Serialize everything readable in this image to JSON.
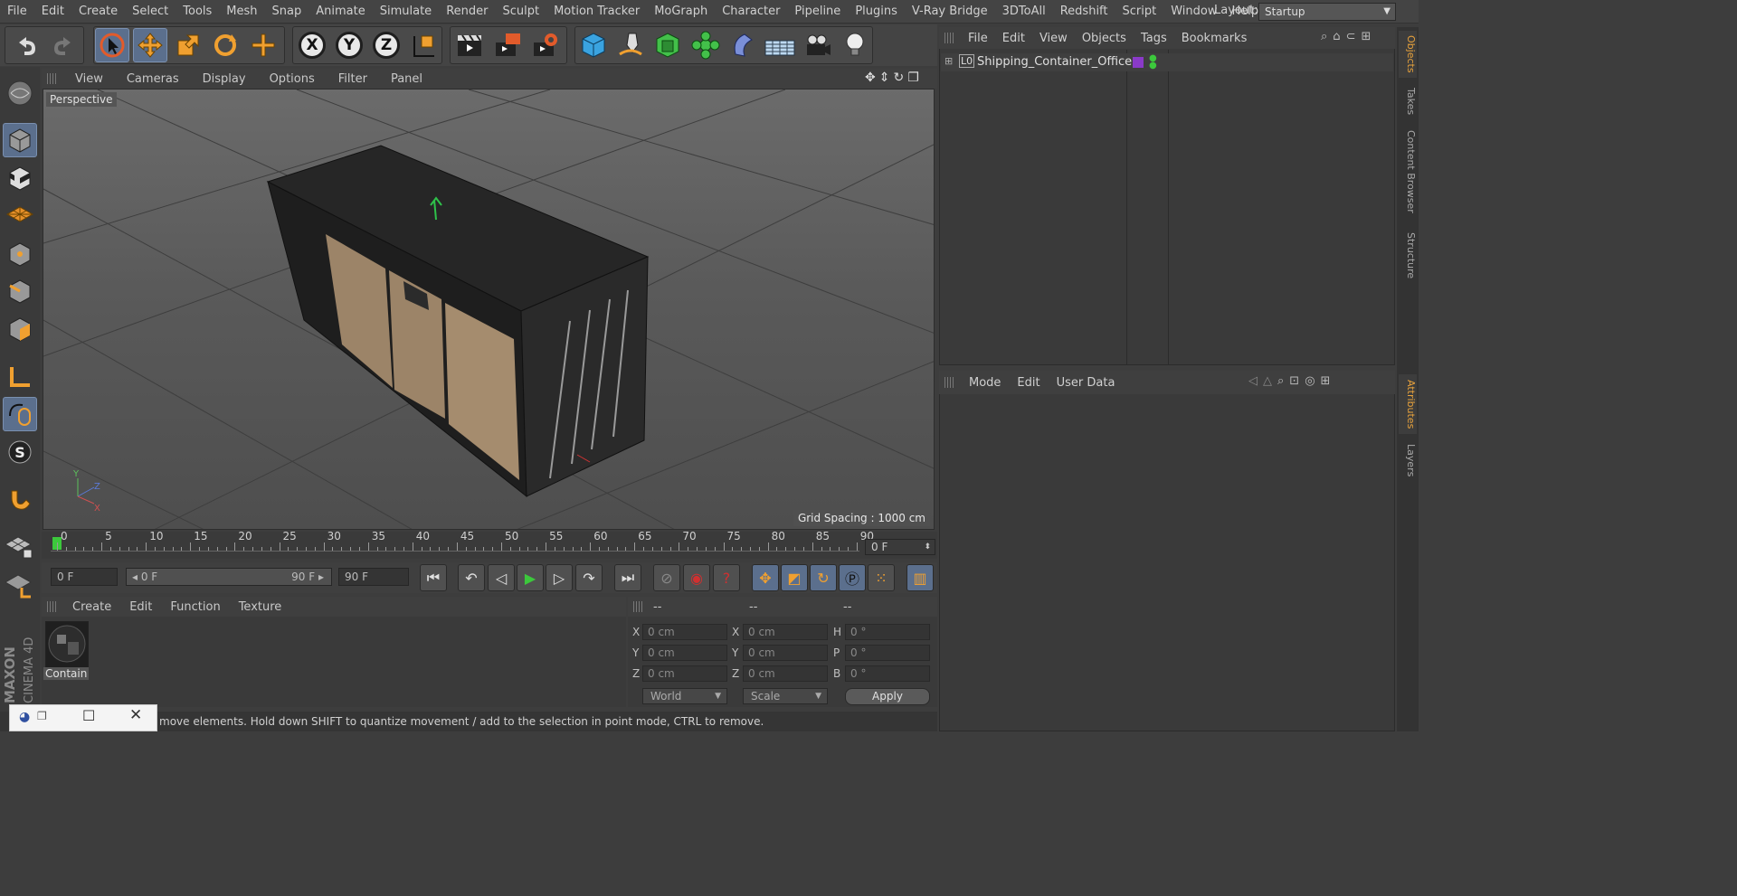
{
  "menubar": {
    "items": [
      "File",
      "Edit",
      "Create",
      "Select",
      "Tools",
      "Mesh",
      "Snap",
      "Animate",
      "Simulate",
      "Render",
      "Sculpt",
      "Motion Tracker",
      "MoGraph",
      "Character",
      "Pipeline",
      "Plugins",
      "V-Ray Bridge",
      "3DToAll",
      "Redshift",
      "Script",
      "Window",
      "Help"
    ],
    "layout_label": "Layout:",
    "layout_value": "Startup"
  },
  "toolbar": {
    "axis_x": "X",
    "axis_y": "Y",
    "axis_z": "Z"
  },
  "viewport": {
    "menu": [
      "View",
      "Cameras",
      "Display",
      "Options",
      "Filter",
      "Panel"
    ],
    "camera_label": "Perspective",
    "grid_spacing": "Grid Spacing : 1000 cm",
    "axis_y": "Y",
    "axis_z": "Z",
    "axis_x": "X"
  },
  "timeline": {
    "ticks": [
      "0",
      "5",
      "10",
      "15",
      "20",
      "25",
      "30",
      "35",
      "40",
      "45",
      "50",
      "55",
      "60",
      "65",
      "70",
      "75",
      "80",
      "85",
      "90"
    ],
    "current_frame": "0 F"
  },
  "transport": {
    "start_frame": "0 F",
    "range_start": "0 F",
    "range_end": "90 F",
    "end_frame": "90 F"
  },
  "material_manager": {
    "menu": [
      "Create",
      "Edit",
      "Function",
      "Texture"
    ],
    "material_name": "Contain"
  },
  "coordinates": {
    "header": [
      "--",
      "--",
      "--"
    ],
    "rows": [
      {
        "l1": "X",
        "v1": "0 cm",
        "l2": "X",
        "v2": "0 cm",
        "l3": "H",
        "v3": "0 °"
      },
      {
        "l1": "Y",
        "v1": "0 cm",
        "l2": "Y",
        "v2": "0 cm",
        "l3": "P",
        "v3": "0 °"
      },
      {
        "l1": "Z",
        "v1": "0 cm",
        "l2": "Z",
        "v2": "0 cm",
        "l3": "B",
        "v3": "0 °"
      }
    ],
    "mode_select": "World",
    "scale_select": "Scale",
    "apply_label": "Apply"
  },
  "objects_panel": {
    "menu": [
      "File",
      "Edit",
      "View",
      "Objects",
      "Tags",
      "Bookmarks"
    ],
    "object_name": "Shipping_Container_Office",
    "layer_badge": "L0"
  },
  "attributes_panel": {
    "menu": [
      "Mode",
      "Edit",
      "User Data"
    ]
  },
  "right_tabs": [
    "Objects",
    "Takes",
    "Content Browser",
    "Structure",
    "Attributes",
    "Layers"
  ],
  "status": {
    "text": "move elements. Hold down SHIFT to quantize movement / add to the selection in point mode, CTRL to remove."
  },
  "branding": {
    "maxon": "MAXON",
    "cinema": "CINEMA 4D"
  },
  "colors": {
    "accent_blue": "#5b6f8d",
    "accent_orange": "#e8a23c",
    "play_green": "#3cc83c",
    "record_red": "#d03030"
  }
}
